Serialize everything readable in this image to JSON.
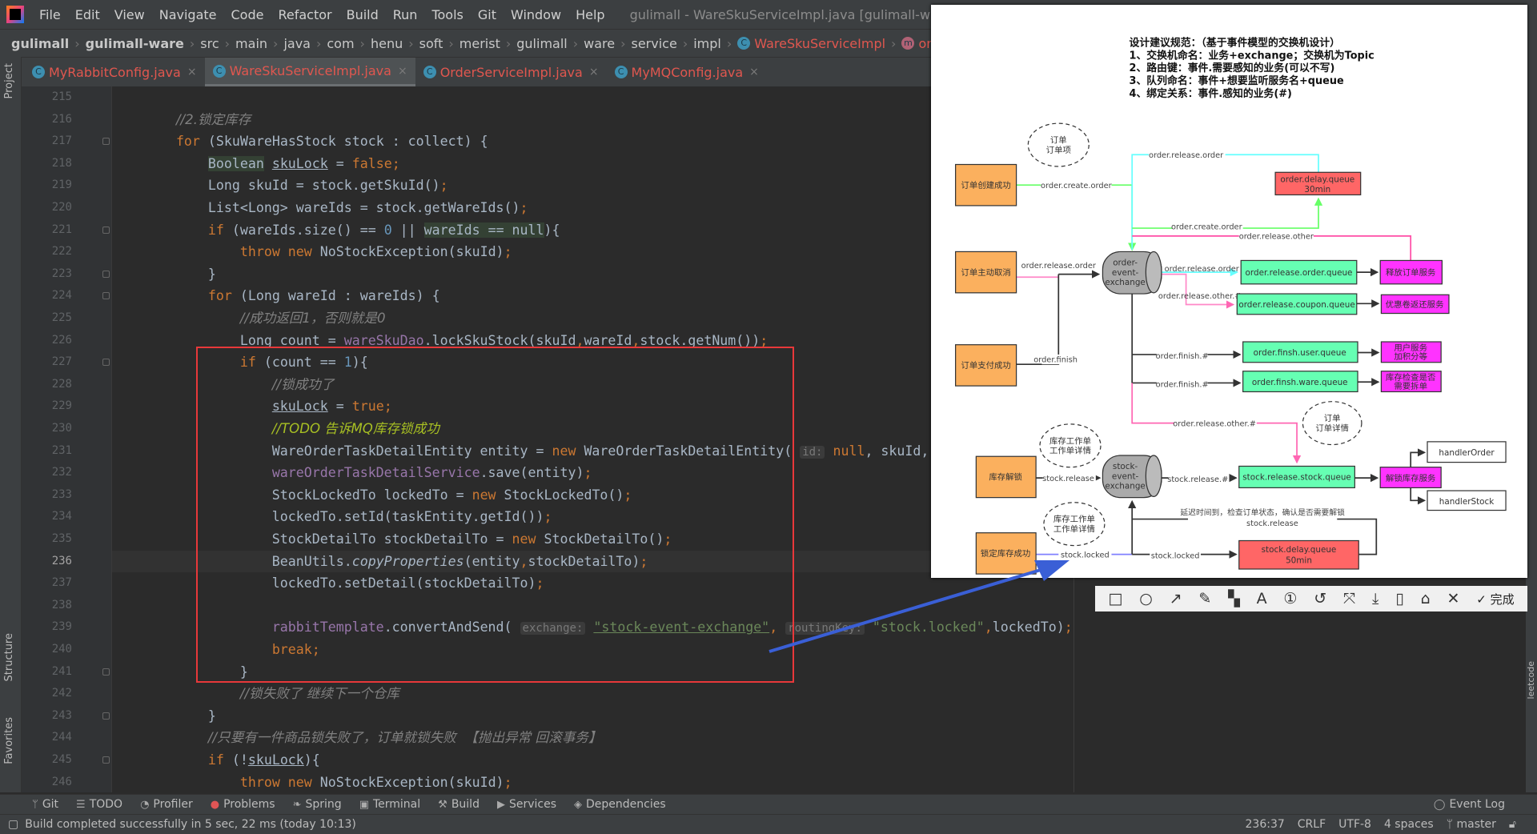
{
  "app": {
    "title": "gulimall - WareSkuServiceImpl.java [gulimall-ware]"
  },
  "menu": [
    "File",
    "Edit",
    "View",
    "Navigate",
    "Code",
    "Refactor",
    "Build",
    "Run",
    "Tools",
    "Git",
    "Window",
    "Help"
  ],
  "breadcrumb": [
    "gulimall",
    "gulimall-ware",
    "src",
    "main",
    "java",
    "com",
    "henu",
    "soft",
    "merist",
    "gulimall",
    "ware",
    "service",
    "impl",
    "WareSkuServiceImpl",
    "orderLockStock"
  ],
  "tabs": [
    {
      "label": "MyRabbitConfig.java"
    },
    {
      "label": "WareSkuServiceImpl.java",
      "active": true
    },
    {
      "label": "OrderServiceImpl.java"
    },
    {
      "label": "MyMQConfig.java"
    }
  ],
  "left_stripe": {
    "project": "Project",
    "structure": "Structure",
    "favorites": "Favorites"
  },
  "right_stripe": {
    "leetcode": "leetcode"
  },
  "code": {
    "current_line": 236,
    "lines": [
      {
        "n": "215",
        "tokens": []
      },
      {
        "n": "216",
        "tokens": [
          {
            "t": "        "
          },
          {
            "t": "//2.锁定库存",
            "c": "cm"
          }
        ]
      },
      {
        "n": "217",
        "tokens": [
          {
            "t": "        "
          },
          {
            "t": "for",
            "c": "kw"
          },
          {
            "t": " (SkuWareHasStock stock : collect) {"
          }
        ]
      },
      {
        "n": "218",
        "tokens": [
          {
            "t": "            "
          },
          {
            "t": "Boolean",
            "c": "hl"
          },
          {
            "t": " "
          },
          {
            "t": "skuLock",
            "c": "ul"
          },
          {
            "t": " = "
          },
          {
            "t": "false",
            "c": "kw"
          },
          {
            "t": ";",
            "c": "kw"
          }
        ]
      },
      {
        "n": "219",
        "tokens": [
          {
            "t": "            Long skuId = stock.getSkuId()"
          },
          {
            "t": ";",
            "c": "kw"
          }
        ]
      },
      {
        "n": "220",
        "tokens": [
          {
            "t": "            List<Long> wareIds = stock.getWareIds()"
          },
          {
            "t": ";",
            "c": "kw"
          }
        ]
      },
      {
        "n": "221",
        "tokens": [
          {
            "t": "            "
          },
          {
            "t": "if",
            "c": "kw"
          },
          {
            "t": " (wareIds.size() == "
          },
          {
            "t": "0",
            "c": "num"
          },
          {
            "t": " || "
          },
          {
            "t": "wareIds == null",
            "c": "hl"
          },
          {
            "t": "){"
          }
        ]
      },
      {
        "n": "222",
        "tokens": [
          {
            "t": "                "
          },
          {
            "t": "throw new",
            "c": "kw"
          },
          {
            "t": " NoStockException(skuId)"
          },
          {
            "t": ";",
            "c": "kw"
          }
        ]
      },
      {
        "n": "223",
        "tokens": [
          {
            "t": "            }"
          }
        ]
      },
      {
        "n": "224",
        "tokens": [
          {
            "t": "            "
          },
          {
            "t": "for",
            "c": "kw"
          },
          {
            "t": " (Long wareId : wareIds) {"
          }
        ]
      },
      {
        "n": "225",
        "tokens": [
          {
            "t": "                "
          },
          {
            "t": "//成功返回1，否则就是0",
            "c": "cm"
          }
        ]
      },
      {
        "n": "226",
        "tokens": [
          {
            "t": "                Long count = "
          },
          {
            "t": "wareSkuDao",
            "c": "fld"
          },
          {
            "t": ".lockSkuStock(skuId"
          },
          {
            "t": ",",
            "c": "kw"
          },
          {
            "t": "wareId"
          },
          {
            "t": ",",
            "c": "kw"
          },
          {
            "t": "stock.getNum())"
          },
          {
            "t": ";",
            "c": "kw"
          }
        ]
      },
      {
        "n": "227",
        "tokens": [
          {
            "t": "                "
          },
          {
            "t": "if",
            "c": "kw"
          },
          {
            "t": " (count == "
          },
          {
            "t": "1",
            "c": "num"
          },
          {
            "t": "){"
          }
        ]
      },
      {
        "n": "228",
        "tokens": [
          {
            "t": "                    "
          },
          {
            "t": "//锁成功了",
            "c": "cm"
          }
        ]
      },
      {
        "n": "229",
        "tokens": [
          {
            "t": "                    "
          },
          {
            "t": "skuLock",
            "c": "ul"
          },
          {
            "t": " = "
          },
          {
            "t": "true",
            "c": "kw"
          },
          {
            "t": ";",
            "c": "kw"
          }
        ]
      },
      {
        "n": "230",
        "tokens": [
          {
            "t": "                    "
          },
          {
            "t": "//TODO 告诉MQ库存锁成功",
            "c": "todo"
          }
        ]
      },
      {
        "n": "231",
        "tokens": [
          {
            "t": "                    WareOrderTaskDetailEntity entity = "
          },
          {
            "t": "new",
            "c": "kw"
          },
          {
            "t": " WareOrderTaskDetailEntity( "
          },
          {
            "t": "id:",
            "c": "hint"
          },
          {
            "t": " "
          },
          {
            "t": "null",
            "c": "kw"
          },
          {
            "t": ", skuId,"
          }
        ]
      },
      {
        "n": "232",
        "tokens": [
          {
            "t": "                    "
          },
          {
            "t": "wareOrderTaskDetailService",
            "c": "fld"
          },
          {
            "t": ".save(entity)"
          },
          {
            "t": ";",
            "c": "kw"
          }
        ]
      },
      {
        "n": "233",
        "tokens": [
          {
            "t": "                    StockLockedTo lockedTo = "
          },
          {
            "t": "new",
            "c": "kw"
          },
          {
            "t": " StockLockedTo()"
          },
          {
            "t": ";",
            "c": "kw"
          }
        ]
      },
      {
        "n": "234",
        "tokens": [
          {
            "t": "                    lockedTo.setId(taskEntity.getId())"
          },
          {
            "t": ";",
            "c": "kw"
          }
        ]
      },
      {
        "n": "235",
        "tokens": [
          {
            "t": "                    StockDetailTo stockDetailTo = "
          },
          {
            "t": "new",
            "c": "kw"
          },
          {
            "t": " StockDetailTo()"
          },
          {
            "t": ";",
            "c": "kw"
          }
        ]
      },
      {
        "n": "236",
        "tokens": [
          {
            "t": "                    BeanUtils."
          },
          {
            "t": "copyProperties",
            "c": "it"
          },
          {
            "t": "(entity"
          },
          {
            "t": ",",
            "c": "kw"
          },
          {
            "t": "stockDetailTo)"
          },
          {
            "t": ";",
            "c": "kw"
          }
        ]
      },
      {
        "n": "237",
        "tokens": [
          {
            "t": "                    lockedTo.setDetail(stockDetailTo)"
          },
          {
            "t": ";",
            "c": "kw"
          }
        ]
      },
      {
        "n": "238",
        "tokens": []
      },
      {
        "n": "239",
        "tokens": [
          {
            "t": "                    "
          },
          {
            "t": "rabbitTemplate",
            "c": "fld"
          },
          {
            "t": ".convertAndSend( "
          },
          {
            "t": "exchange:",
            "c": "hint"
          },
          {
            "t": " "
          },
          {
            "t": "\"stock-event-exchange\"",
            "c": "strul"
          },
          {
            "t": ", ",
            "c": "kw"
          },
          {
            "t": "routingKey:",
            "c": "hint"
          },
          {
            "t": " "
          },
          {
            "t": "\"stock.locked\"",
            "c": "str"
          },
          {
            "t": ",",
            "c": "kw"
          },
          {
            "t": "lockedTo)"
          },
          {
            "t": ";",
            "c": "kw"
          }
        ]
      },
      {
        "n": "240",
        "tokens": [
          {
            "t": "                    "
          },
          {
            "t": "break;",
            "c": "kw"
          }
        ]
      },
      {
        "n": "241",
        "tokens": [
          {
            "t": "                }"
          }
        ]
      },
      {
        "n": "242",
        "tokens": [
          {
            "t": "                "
          },
          {
            "t": "//锁失败了 继续下一个仓库",
            "c": "cm"
          }
        ]
      },
      {
        "n": "243",
        "tokens": [
          {
            "t": "            }"
          }
        ]
      },
      {
        "n": "244",
        "tokens": [
          {
            "t": "            "
          },
          {
            "t": "//只要有一件商品锁失败了，订单就锁失败  【抛出异常 回滚事务】",
            "c": "cm"
          }
        ]
      },
      {
        "n": "245",
        "tokens": [
          {
            "t": "            "
          },
          {
            "t": "if",
            "c": "kw"
          },
          {
            "t": " (!"
          },
          {
            "t": "skuLock",
            "c": "ul"
          },
          {
            "t": "){"
          }
        ]
      },
      {
        "n": "246",
        "tokens": [
          {
            "t": "                "
          },
          {
            "t": "throw new",
            "c": "kw"
          },
          {
            "t": " NoStockException(skuId)"
          },
          {
            "t": ";",
            "c": "kw"
          }
        ]
      }
    ]
  },
  "diagram": {
    "heading": [
      "设计建议规范：（基于事件模型的交换机设计）",
      "1、交换机命名：业务+exchange；交换机为Topic",
      "2、路由键：事件.需要感知的业务(可以不写)",
      "3、队列命名：事件+想要监听服务名+queue",
      "4、绑定关系：事件.感知的业务(#)"
    ],
    "events": {
      "order_created": "订单创建成功",
      "order_cancel": "订单主动取消",
      "order_paid": "订单支付成功",
      "stock_unlock": "库存解锁",
      "stock_locked": "锁定库存成功"
    },
    "notes": {
      "order_items": [
        "订单",
        "订单项"
      ],
      "order_detail": [
        "订单",
        "订单详情"
      ],
      "stock_task1": [
        "库存工作单",
        "工作单详情"
      ],
      "stock_task2": [
        "库存工作单",
        "工作单详情"
      ]
    },
    "exchanges": {
      "order": [
        "order-",
        "event-",
        "exchange"
      ],
      "stock": [
        "stock-",
        "event-",
        "exchange"
      ]
    },
    "queues": {
      "order_delay": [
        "order.delay.queue",
        "30min"
      ],
      "release_order": "order.release.order.queue",
      "release_coupon": "order.release.coupon.queue",
      "finish_user": "order.finsh.user.queue",
      "finish_ware": "order.finsh.ware.queue",
      "release_stock": "stock.release.stock.queue",
      "stock_delay": [
        "stock.delay.queue",
        "50min"
      ]
    },
    "services": {
      "release_order": "释放订单服务",
      "coupon_return": "优惠卷返还服务",
      "user_points": [
        "用户服务",
        "加积分等"
      ],
      "stock_check": [
        "库存检查是否",
        "需要拆单"
      ],
      "unlock_stock": "解锁库存服务",
      "handler_order": "handlerOrder",
      "handler_stock": "handlerStock"
    },
    "routes": {
      "create1": "order.create.order",
      "release_top": "order.release.order",
      "create2": "order.create.order",
      "release_other": "order.release.other",
      "cancel": "order.release.order",
      "ex_release": "order.release.order",
      "ex_other": "order.release.other.#",
      "finish": "order.finish",
      "finish1": "order.finish.#",
      "finish2": "order.finish.#",
      "other2": "order.release.other.#",
      "stock_release": "stock.release",
      "stock_release_all": "stock.release.#",
      "locked1": "stock.locked",
      "locked2": "stock.locked",
      "delay_note": "延迟时间到，检查订单状态，确认是否需要解锁",
      "delay_key": "stock.release"
    },
    "colors": {
      "event": "#fbb05e",
      "queue": "#66ffb3",
      "delay": "#ff6666",
      "service": "#ff33ff",
      "exchange": "#aaaaaa"
    }
  },
  "screenshot_toolbar": {
    "icons": [
      "rectangle-icon",
      "ellipse-icon",
      "arrow-icon",
      "pencil-icon",
      "mosaic-icon",
      "text-icon",
      "number-icon",
      "undo-icon",
      "pin-icon",
      "download-icon",
      "phone-icon",
      "bookmark-icon",
      "close-icon",
      "check-icon"
    ],
    "done": "完成"
  },
  "tool_windows": [
    "Git",
    "TODO",
    "Profiler",
    "Problems",
    "Spring",
    "Terminal",
    "Build",
    "Services",
    "Dependencies"
  ],
  "event_log": "Event Log",
  "status": {
    "message": "Build completed successfully in 5 sec, 22 ms (today 10:13)",
    "position": "236:37",
    "line_sep": "CRLF",
    "encoding": "UTF-8",
    "indent": "4 spaces",
    "branch": "master"
  },
  "annotation_colors": {
    "rectangle": "#e8383a",
    "arrow": "#3a5fd6"
  }
}
